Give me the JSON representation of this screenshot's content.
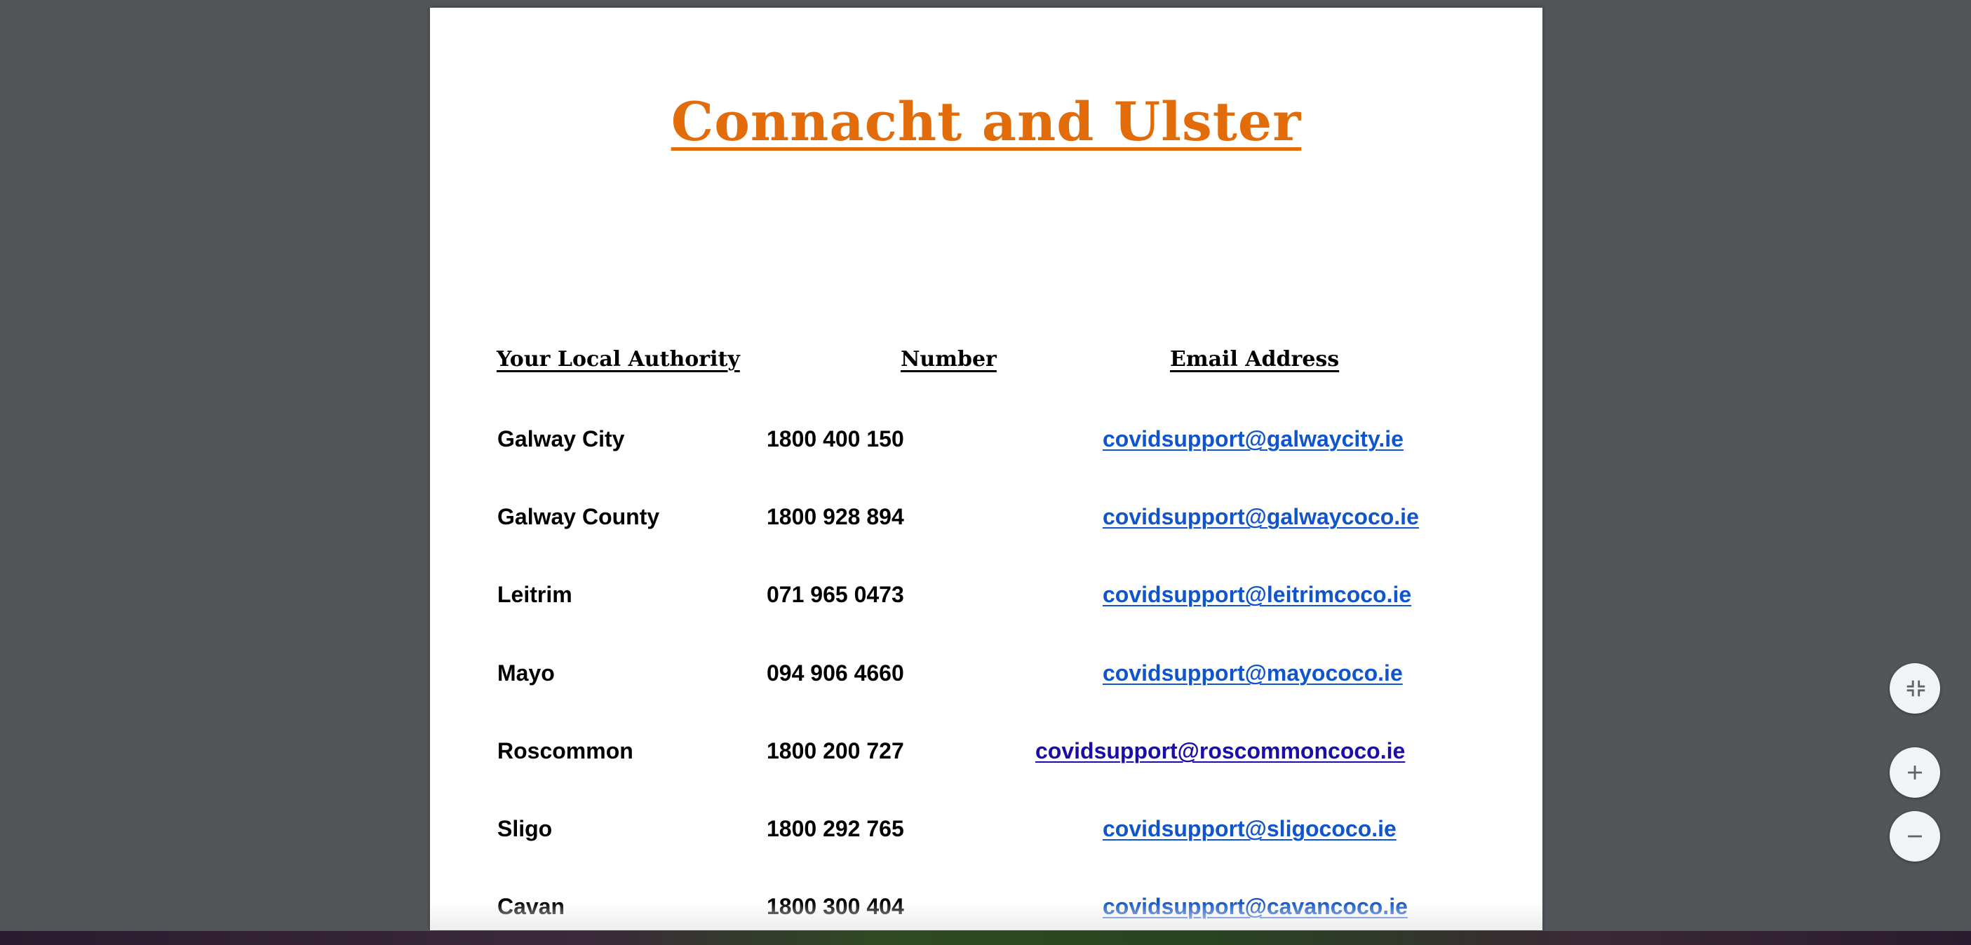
{
  "document": {
    "title": "Connacht and Ulster",
    "title_color": "#e36c0a",
    "headers": {
      "authority": "Your Local Authority",
      "number": "Number",
      "email": "Email Address"
    },
    "rows": [
      {
        "authority": "Galway City",
        "number": "1800 400 150",
        "email": "covidsupport@galwaycity.ie"
      },
      {
        "authority": "Galway County",
        "number": "1800 928 894",
        "email": "covidsupport@galwaycoco.ie"
      },
      {
        "authority": "Leitrim",
        "number": "071 965 0473",
        "email": "covidsupport@leitrimcoco.ie"
      },
      {
        "authority": "Mayo",
        "number": "094 906 4660",
        "email": "covidsupport@mayococo.ie"
      },
      {
        "authority": "Roscommon",
        "number": "1800 200 727",
        "email": "covidsupport@roscommoncoco.ie"
      },
      {
        "authority": "Sligo",
        "number": "1800 292 765",
        "email": "covidsupport@sligococo.ie"
      },
      {
        "authority": "Cavan",
        "number": "1800 300 404",
        "email": "covidsupport@cavancoco.ie"
      }
    ],
    "link_color": "#1155cc",
    "visited_link_color": "#1a0dab"
  },
  "controls": {
    "fit": {
      "icon": "fit-to-page-icon"
    },
    "zoom_in": {
      "icon": "plus-icon"
    },
    "zoom_out": {
      "icon": "minus-icon"
    }
  },
  "viewer_background": "#525659"
}
